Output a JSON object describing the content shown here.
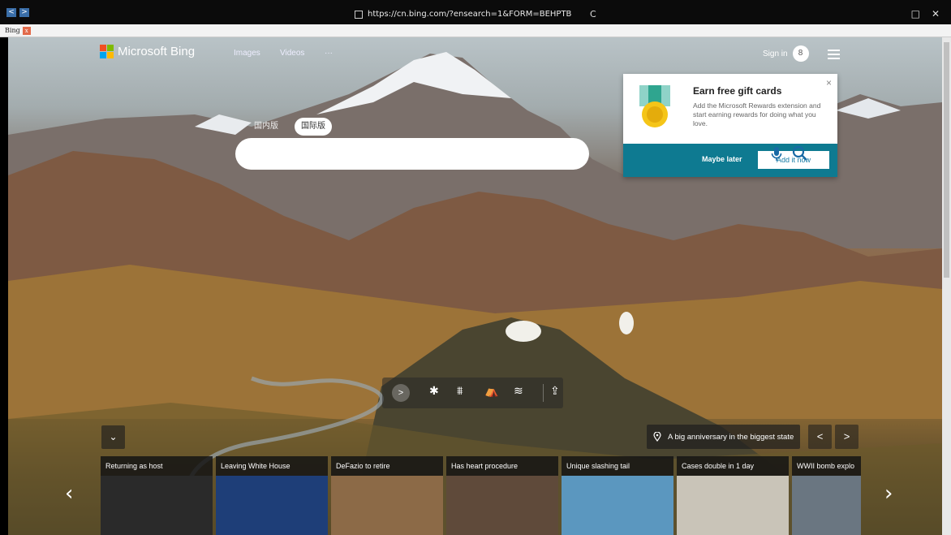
{
  "browser": {
    "nav_back": "<",
    "nav_forward": ">",
    "url": "https://cn.bing.com/?ensearch=1&FORM=BEHPTB",
    "reload": "C",
    "maximize": "□",
    "close": "✕",
    "tab_title": "Bing",
    "tab_close": "x"
  },
  "header": {
    "logo_text": "Microsoft Bing",
    "nav": [
      "Images",
      "Videos",
      "···"
    ],
    "sign_in": "Sign in",
    "avatar_glyph": "8"
  },
  "rewards_popup": {
    "title": "Earn free gift cards",
    "body": "Add the Microsoft Rewards extension and start earning rewards for doing what you love.",
    "close": "×",
    "maybe_later": "Maybe later",
    "add_now": "Add it now"
  },
  "search": {
    "lang_domestic": "国内版",
    "lang_international": "国际版",
    "placeholder": ""
  },
  "toolbar": {
    "next": ">",
    "icons": [
      "snowflake-icon",
      "fence-icon",
      "camp-icon",
      "wind-icon",
      "share-icon"
    ],
    "glyphs": [
      "✱",
      "⩩",
      "⛺",
      "≋",
      "⇪"
    ]
  },
  "bottom": {
    "collapse": "⌄",
    "location_text": "A big anniversary in the biggest state",
    "prev": "<",
    "next": ">",
    "carousel_prev": "‹",
    "carousel_next": "›"
  },
  "news_cards": [
    {
      "caption": "Returning as host",
      "color": "#2a2a2a"
    },
    {
      "caption": "Leaving White House",
      "color": "#1e3e78"
    },
    {
      "caption": "DeFazio to retire",
      "color": "#8c6a47"
    },
    {
      "caption": "Has heart procedure",
      "color": "#5f4a3a"
    },
    {
      "caption": "Unique slashing tail",
      "color": "#5b97bf"
    },
    {
      "caption": "Cases double in 1 day",
      "color": "#c9c4b8"
    },
    {
      "caption": "WWII bomb explo",
      "color": "#6a7681"
    }
  ],
  "colors": {
    "popup_footer": "#0e7a91",
    "add_now_text": "#137aa3",
    "tab_close": "#e26a4a"
  }
}
